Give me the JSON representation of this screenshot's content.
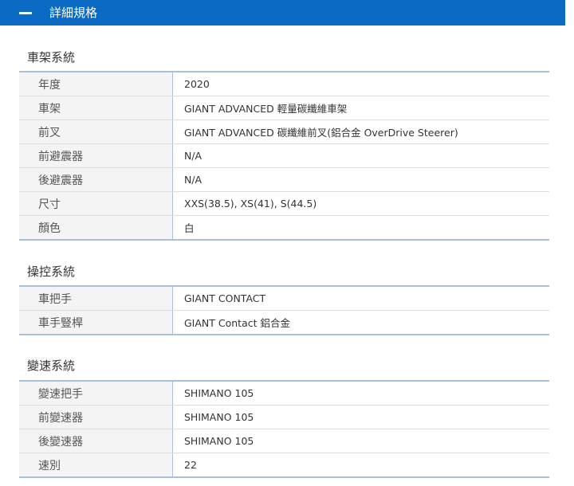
{
  "header": {
    "title": "詳細規格"
  },
  "sections": [
    {
      "title": "車架系統",
      "rows": [
        {
          "label": "年度",
          "value": "2020"
        },
        {
          "label": "車架",
          "value": "GIANT ADVANCED 輕量碳纖維車架"
        },
        {
          "label": "前叉",
          "value": "GIANT ADVANCED 碳纖維前叉(鋁合金 OverDrive Steerer)"
        },
        {
          "label": "前避震器",
          "value": "N/A"
        },
        {
          "label": "後避震器",
          "value": "N/A"
        },
        {
          "label": "尺寸",
          "value": "XXS(38.5), XS(41), S(44.5)"
        },
        {
          "label": "顏色",
          "value": "白"
        }
      ]
    },
    {
      "title": "操控系統",
      "rows": [
        {
          "label": "車把手",
          "value": "GIANT CONTACT"
        },
        {
          "label": "車手豎桿",
          "value": "GIANT Contact 鋁合金"
        }
      ]
    },
    {
      "title": "變速系統",
      "rows": [
        {
          "label": "變速把手",
          "value": "SHIMANO 105"
        },
        {
          "label": "前變速器",
          "value": "SHIMANO 105"
        },
        {
          "label": "後變速器",
          "value": "SHIMANO 105"
        },
        {
          "label": "速別",
          "value": "22"
        }
      ]
    }
  ],
  "colors": {
    "header_bg": "#0b6bc4",
    "table_border": "#a7c0dc",
    "label_bg": "#f4f4f4"
  },
  "icons": {
    "header_toggle": "minus-icon"
  }
}
